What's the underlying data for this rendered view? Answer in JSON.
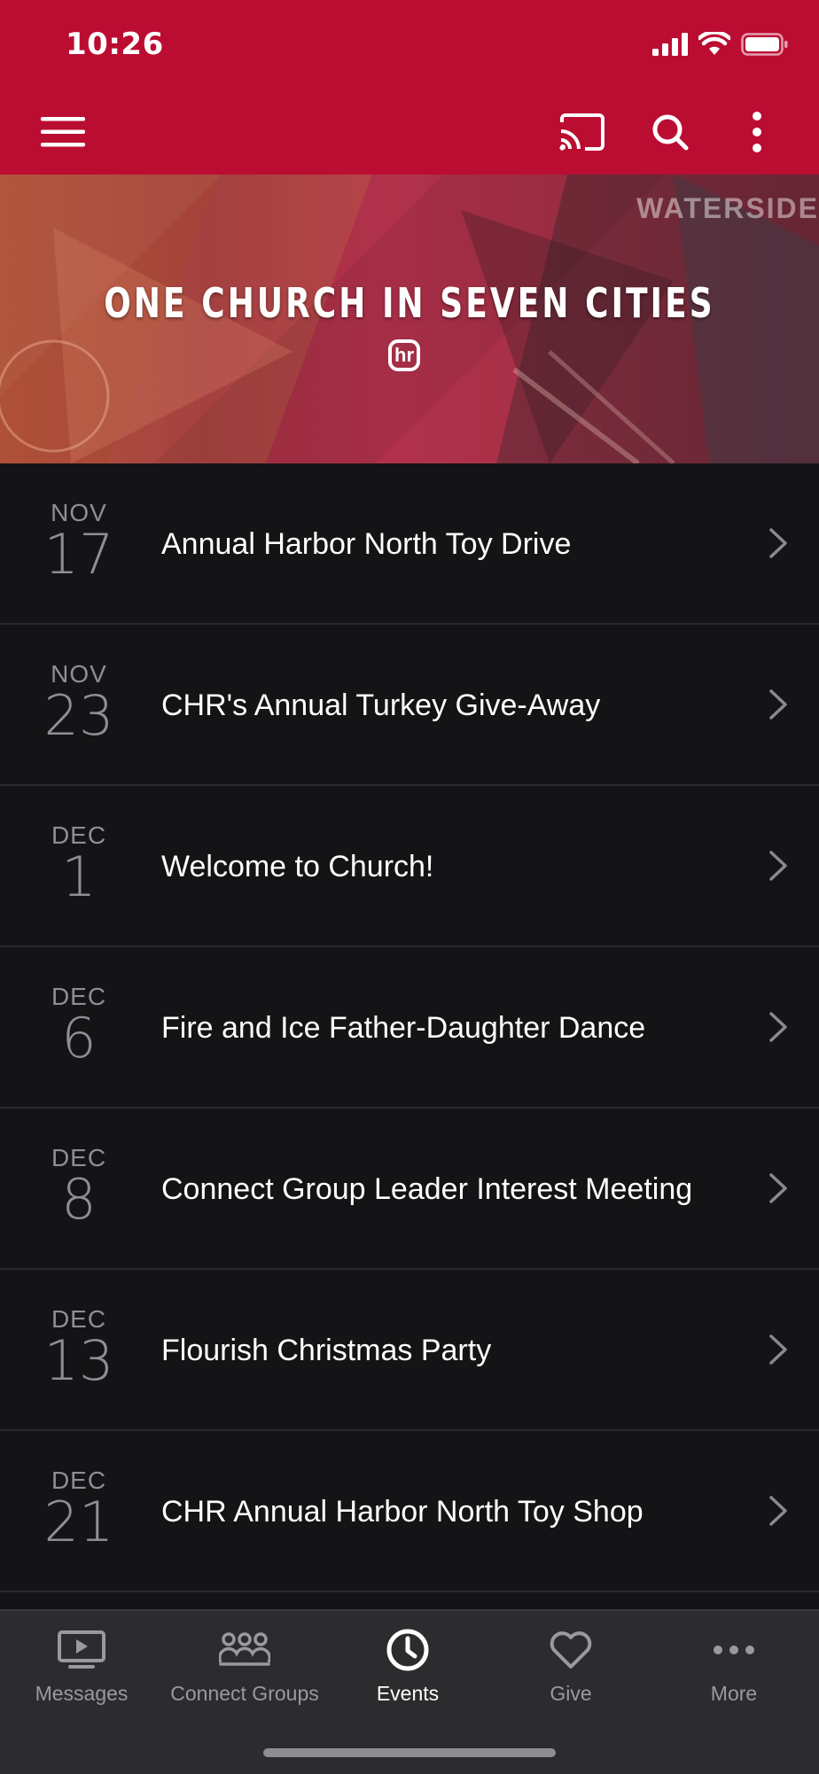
{
  "status": {
    "time": "10:26"
  },
  "appbar": {
    "menu_icon": "hamburger-icon",
    "cast_icon": "cast-icon",
    "search_icon": "search-icon",
    "more_icon": "vertical-dots-icon",
    "color": "#bb0d32"
  },
  "hero": {
    "title": "ONE CHURCH IN SEVEN CITIES",
    "logo": "hr",
    "building_sign": "WATERSIDE"
  },
  "events": [
    {
      "month": "NOV",
      "day": "17",
      "title": "Annual Harbor North Toy Drive"
    },
    {
      "month": "NOV",
      "day": "23",
      "title": "CHR's Annual Turkey Give-Away"
    },
    {
      "month": "DEC",
      "day": "1",
      "title": "Welcome to Church!"
    },
    {
      "month": "DEC",
      "day": "6",
      "title": "Fire and Ice Father-Daughter Dance"
    },
    {
      "month": "DEC",
      "day": "8",
      "title": "Connect Group Leader Interest Meeting"
    },
    {
      "month": "DEC",
      "day": "13",
      "title": "Flourish Christmas Party"
    },
    {
      "month": "DEC",
      "day": "21",
      "title": "CHR Annual Harbor North Toy Shop"
    }
  ],
  "tabs": [
    {
      "label": "Messages",
      "icon": "tv-icon",
      "active": false
    },
    {
      "label": "Connect Groups",
      "icon": "group-icon",
      "active": false
    },
    {
      "label": "Events",
      "icon": "clock-icon",
      "active": true
    },
    {
      "label": "Give",
      "icon": "heart-icon",
      "active": false
    },
    {
      "label": "More",
      "icon": "horizontal-dots-icon",
      "active": false
    }
  ]
}
